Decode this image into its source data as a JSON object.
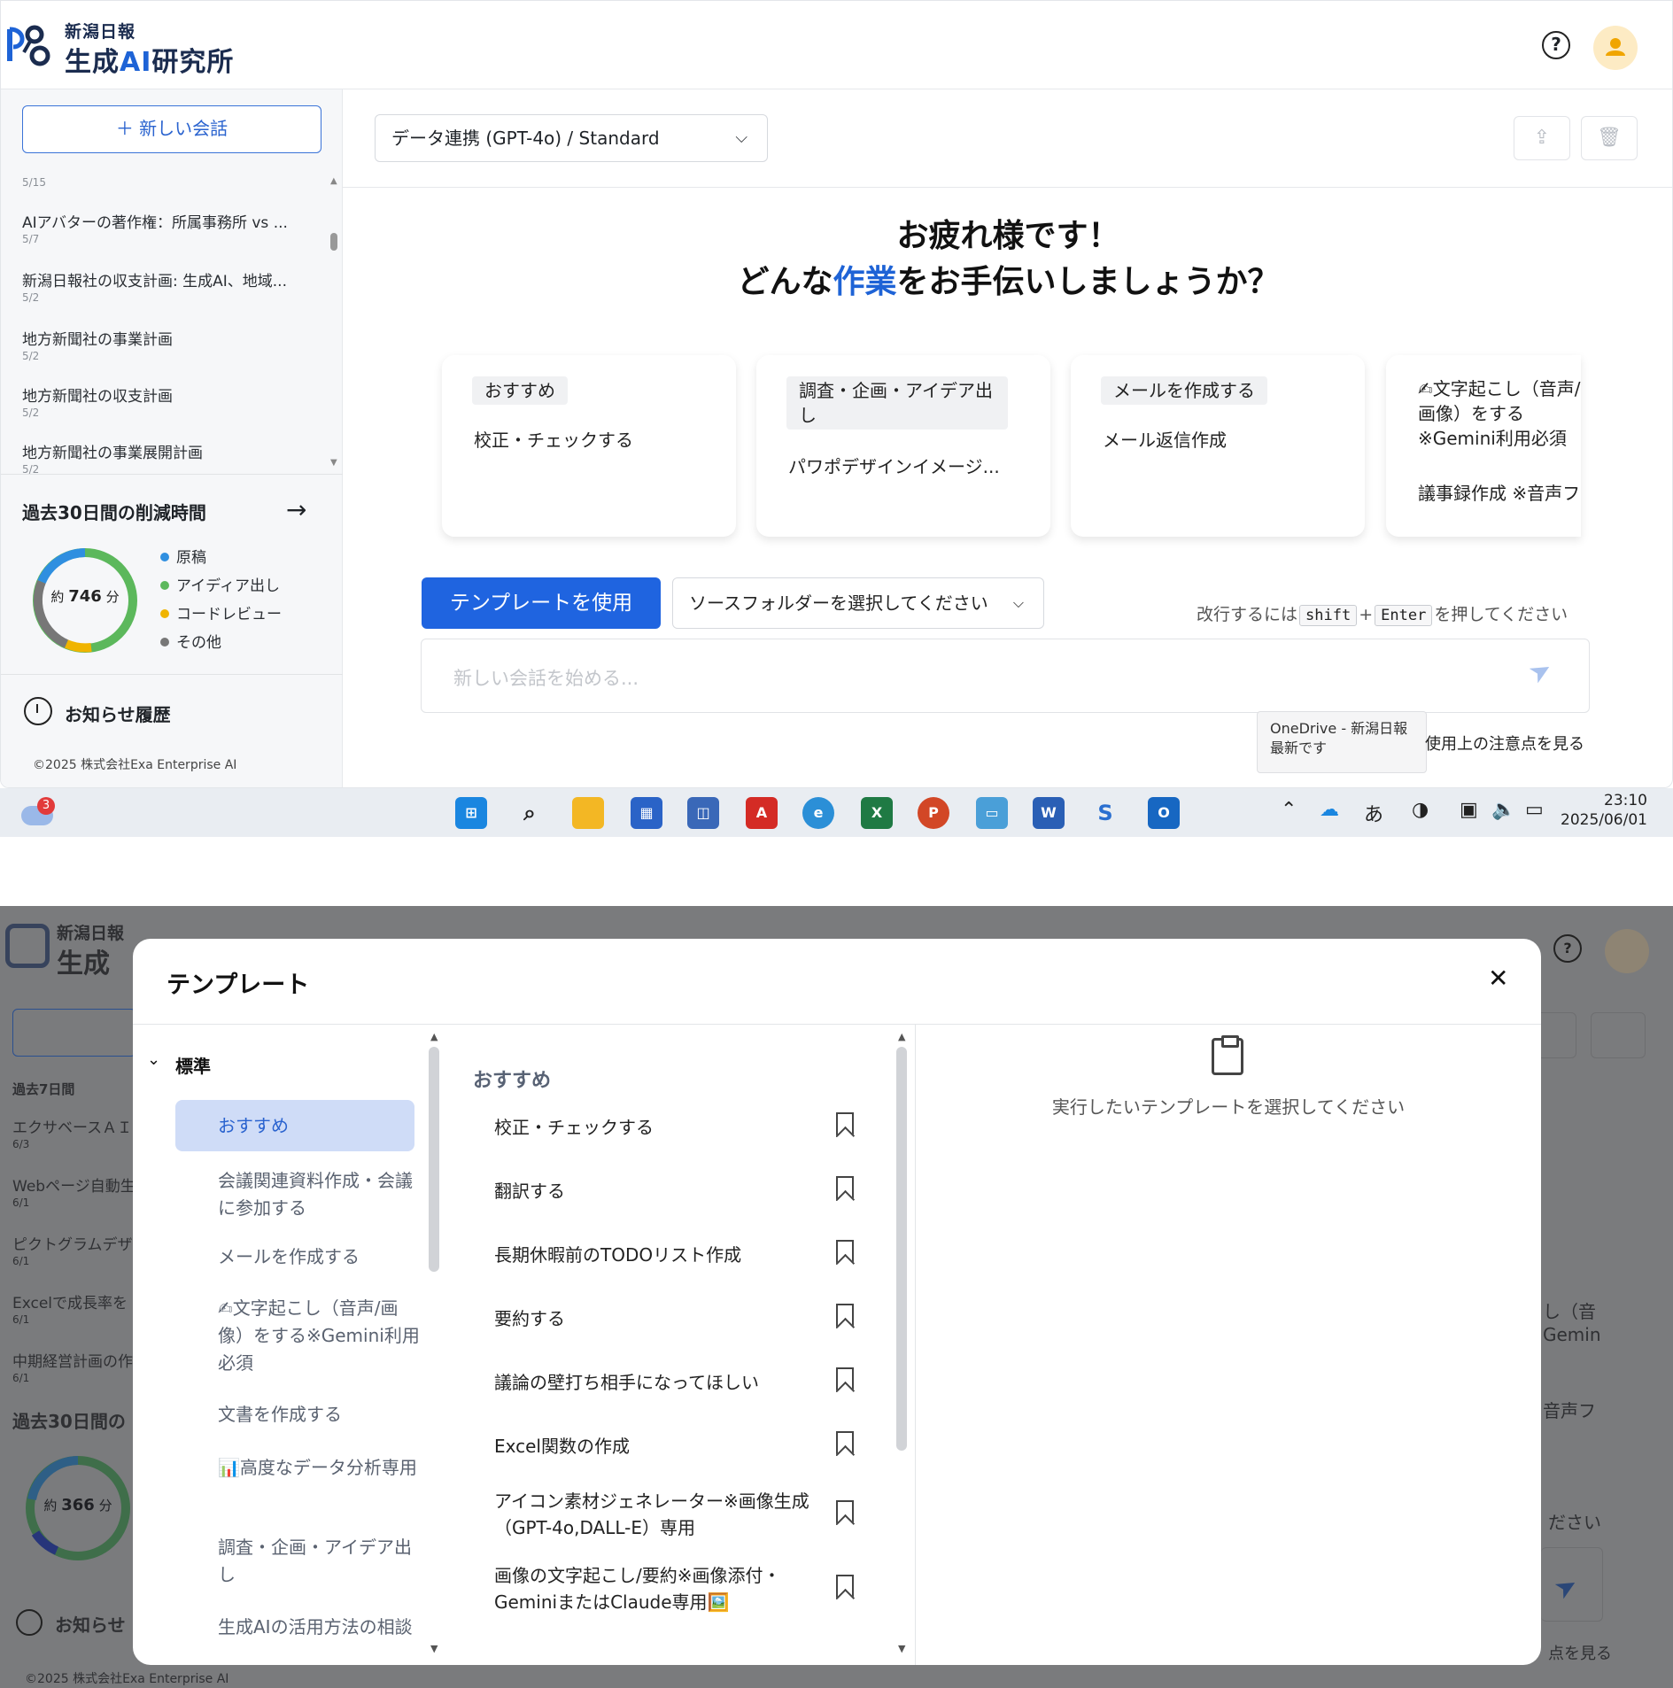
{
  "brand": {
    "sub": "新潟日報",
    "main_prefix": "生成",
    "main_ai": "AI",
    "main_suffix": "研究所"
  },
  "header": {
    "help_label": "?"
  },
  "sidebar": {
    "new_chat": "＋ 新しい会話",
    "history": [
      {
        "title": "",
        "date": "5/15"
      },
      {
        "title": "AIアバターの著作権：所属事務所 vs ...",
        "date": "5/7"
      },
      {
        "title": "新潟日報社の収支計画: 生成AI、地域...",
        "date": "5/2"
      },
      {
        "title": "地方新聞社の事業計画",
        "date": "5/2"
      },
      {
        "title": "地方新聞社の収支計画",
        "date": "5/2"
      },
      {
        "title": "地方新聞社の事業展開計画",
        "date": "5/2"
      }
    ],
    "saving": {
      "title": "過去30日間の削減時間",
      "approx": "約",
      "value": "746",
      "unit": "分",
      "legend": [
        {
          "label": "原稿",
          "color": "#2f8fe0"
        },
        {
          "label": "アイディア出し",
          "color": "#5cb85c"
        },
        {
          "label": "コードレビュー",
          "color": "#f0b400"
        },
        {
          "label": "その他",
          "color": "#777777"
        }
      ]
    },
    "notice_title": "お知らせ履歴",
    "copyright": "©2025 株式会社Exa Enterprise AI"
  },
  "main": {
    "model_select": "データ連携 (GPT-4o) / Standard",
    "greet_line1": "お疲れ様です！",
    "greet_pre": "どんな",
    "greet_hl": "作業",
    "greet_post": "をお手伝いしましょうか？",
    "cards": [
      {
        "chip": "おすすめ",
        "text": "校正・チェックする"
      },
      {
        "chip": "調査・企画・アイデア出し",
        "text": "パワポデザインイメージ..."
      },
      {
        "chip": "メールを作成する",
        "text": "メール返信作成"
      },
      {
        "chip": "✍文字起こし（音声/画像）をする※Gemini利用必須",
        "text": "議事録作成 ※音声フ"
      }
    ],
    "use_template": "テンプレートを使用",
    "folder_select": "ソースフォルダーを選択してください",
    "hint_pre": "改行するには",
    "hint_key1": "shift",
    "hint_plus": "+",
    "hint_key2": "Enter",
    "hint_post": "を押してください",
    "input_placeholder": "新しい会話を始める...",
    "onedrive_line1": "OneDrive - 新潟日報",
    "onedrive_line2": "最新です",
    "notes_link": "使用上の注意点を見る"
  },
  "taskbar": {
    "weather_badge": "3",
    "ime": "あ",
    "time": "23:10",
    "date": "2025/06/01"
  },
  "bg2": {
    "history_head": "過去7日間",
    "history": [
      {
        "title": "エクサベースＡＩ",
        "date": "6/3"
      },
      {
        "title": "Webページ自動生",
        "date": "6/1"
      },
      {
        "title": "ピクトグラムデザ",
        "date": "6/1"
      },
      {
        "title": "Excelで成長率を",
        "date": "6/1"
      },
      {
        "title": "中期経営計画の作",
        "date": "6/1"
      }
    ],
    "saving_title": "過去30日間の",
    "approx": "約",
    "value": "366",
    "unit": "分",
    "notice": "お知らせ",
    "copyright": "©2025 株式会社Exa Enterprise AI",
    "right_text1": "し（音",
    "right_text2": "Gemin",
    "right_text3": "音声フ",
    "right_hint": "ださい",
    "right_notes": "点を見る"
  },
  "modal": {
    "title": "テンプレート",
    "group": "標準",
    "categories": [
      "おすすめ",
      "会議関連資料作成・会議に参加する",
      "メールを作成する",
      "✍文字起こし（音声/画像）をする※Gemini利用必須",
      "文書を作成する",
      "📊高度なデータ分析専用",
      "調査・企画・アイデア出し",
      "生成AIの活用方法の相談"
    ],
    "list_head": "おすすめ",
    "items": [
      "校正・チェックする",
      "翻訳する",
      "長期休暇前のTODOリスト作成",
      "要約する",
      "議論の壁打ち相手になってほしい",
      "Excel関数の作成",
      "アイコン素材ジェネレーター※画像生成（GPT-4o,DALL-E）専用",
      "画像の文字起こし/要約※画像添付・GeminiまたはClaude専用🖼️"
    ],
    "empty_message": "実行したいテンプレートを選択してください"
  }
}
